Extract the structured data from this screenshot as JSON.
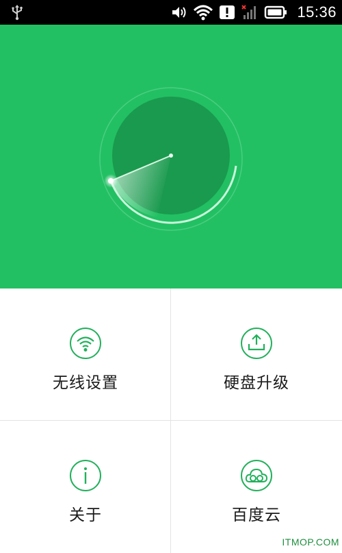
{
  "status_bar": {
    "time": "15:36",
    "icons": [
      "usb-icon",
      "volume-icon",
      "wifi-icon",
      "alert-icon",
      "no-signal-icon",
      "battery-icon"
    ]
  },
  "menu": {
    "items": [
      {
        "label": "无线设置",
        "icon": "wifi-icon"
      },
      {
        "label": "硬盘升级",
        "icon": "upload-icon"
      },
      {
        "label": "关于",
        "icon": "info-icon"
      },
      {
        "label": "百度云",
        "icon": "cloud-icon"
      }
    ]
  },
  "watermark": "ITMOP.COM",
  "colors": {
    "accent": "#22c063",
    "accent_dark": "#1a9a4e",
    "status_bar": "#000000"
  }
}
